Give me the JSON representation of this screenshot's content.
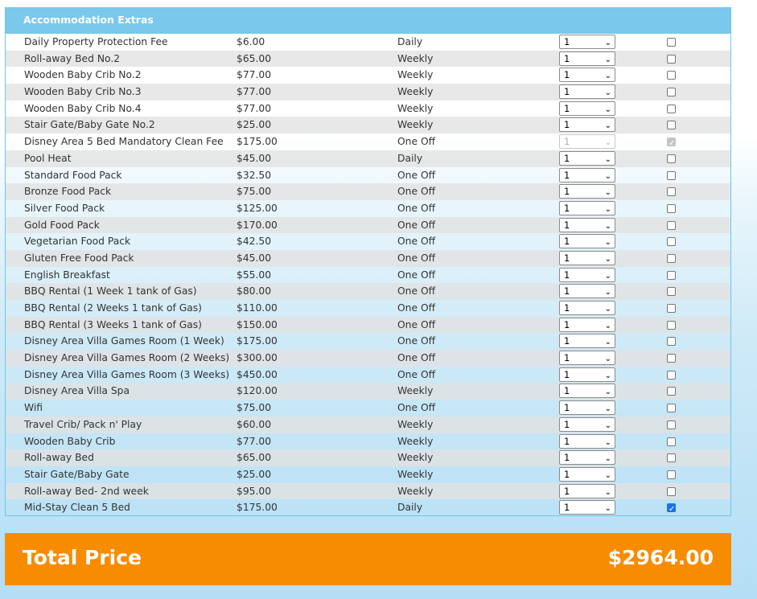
{
  "header": {
    "title": "Accommodation Extras"
  },
  "extras": [
    {
      "name": "Daily Property Protection Fee",
      "price": "$6.00",
      "frequency": "Daily",
      "qty": "1",
      "checked": false,
      "disabled": false
    },
    {
      "name": "Roll-away Bed No.2",
      "price": "$65.00",
      "frequency": "Weekly",
      "qty": "1",
      "checked": false,
      "disabled": false
    },
    {
      "name": "Wooden Baby Crib No.2",
      "price": "$77.00",
      "frequency": "Weekly",
      "qty": "1",
      "checked": false,
      "disabled": false
    },
    {
      "name": "Wooden Baby Crib No.3",
      "price": "$77.00",
      "frequency": "Weekly",
      "qty": "1",
      "checked": false,
      "disabled": false
    },
    {
      "name": "Wooden Baby Crib No.4",
      "price": "$77.00",
      "frequency": "Weekly",
      "qty": "1",
      "checked": false,
      "disabled": false
    },
    {
      "name": "Stair Gate/Baby Gate No.2",
      "price": "$25.00",
      "frequency": "Weekly",
      "qty": "1",
      "checked": false,
      "disabled": false
    },
    {
      "name": "Disney Area 5 Bed Mandatory Clean Fee",
      "price": "$175.00",
      "frequency": "One Off",
      "qty": "1",
      "checked": true,
      "disabled": true
    },
    {
      "name": "Pool Heat",
      "price": "$45.00",
      "frequency": "Daily",
      "qty": "1",
      "checked": false,
      "disabled": false
    },
    {
      "name": "Standard Food Pack",
      "price": "$32.50",
      "frequency": "One Off",
      "qty": "1",
      "checked": false,
      "disabled": false
    },
    {
      "name": "Bronze Food Pack",
      "price": "$75.00",
      "frequency": "One Off",
      "qty": "1",
      "checked": false,
      "disabled": false
    },
    {
      "name": "Silver Food Pack",
      "price": "$125.00",
      "frequency": "One Off",
      "qty": "1",
      "checked": false,
      "disabled": false
    },
    {
      "name": "Gold Food Pack",
      "price": "$170.00",
      "frequency": "One Off",
      "qty": "1",
      "checked": false,
      "disabled": false
    },
    {
      "name": "Vegetarian Food Pack",
      "price": "$42.50",
      "frequency": "One Off",
      "qty": "1",
      "checked": false,
      "disabled": false
    },
    {
      "name": "Gluten Free Food Pack",
      "price": "$45.00",
      "frequency": "One Off",
      "qty": "1",
      "checked": false,
      "disabled": false
    },
    {
      "name": "English Breakfast",
      "price": "$55.00",
      "frequency": "One Off",
      "qty": "1",
      "checked": false,
      "disabled": false
    },
    {
      "name": "BBQ Rental (1 Week 1 tank of Gas)",
      "price": "$80.00",
      "frequency": "One Off",
      "qty": "1",
      "checked": false,
      "disabled": false
    },
    {
      "name": "BBQ Rental (2 Weeks 1 tank of Gas)",
      "price": "$110.00",
      "frequency": "One Off",
      "qty": "1",
      "checked": false,
      "disabled": false
    },
    {
      "name": "BBQ Rental (3 Weeks 1 tank of Gas)",
      "price": "$150.00",
      "frequency": "One Off",
      "qty": "1",
      "checked": false,
      "disabled": false
    },
    {
      "name": "Disney Area Villa Games Room (1 Week)",
      "price": "$175.00",
      "frequency": "One Off",
      "qty": "1",
      "checked": false,
      "disabled": false
    },
    {
      "name": "Disney Area Villa Games Room (2 Weeks)",
      "price": "$300.00",
      "frequency": "One Off",
      "qty": "1",
      "checked": false,
      "disabled": false
    },
    {
      "name": "Disney Area Villa Games Room (3 Weeks)",
      "price": "$450.00",
      "frequency": "One Off",
      "qty": "1",
      "checked": false,
      "disabled": false
    },
    {
      "name": "Disney Area Villa Spa",
      "price": "$120.00",
      "frequency": "Weekly",
      "qty": "1",
      "checked": false,
      "disabled": false
    },
    {
      "name": "Wifi",
      "price": "$75.00",
      "frequency": "One Off",
      "qty": "1",
      "checked": false,
      "disabled": false
    },
    {
      "name": "Travel Crib/ Pack n' Play",
      "price": "$60.00",
      "frequency": "Weekly",
      "qty": "1",
      "checked": false,
      "disabled": false
    },
    {
      "name": "Wooden Baby Crib",
      "price": "$77.00",
      "frequency": "Weekly",
      "qty": "1",
      "checked": false,
      "disabled": false
    },
    {
      "name": "Roll-away Bed",
      "price": "$65.00",
      "frequency": "Weekly",
      "qty": "1",
      "checked": false,
      "disabled": false
    },
    {
      "name": "Stair Gate/Baby Gate",
      "price": "$25.00",
      "frequency": "Weekly",
      "qty": "1",
      "checked": false,
      "disabled": false
    },
    {
      "name": "Roll-away Bed- 2nd week",
      "price": "$95.00",
      "frequency": "Weekly",
      "qty": "1",
      "checked": false,
      "disabled": false
    },
    {
      "name": "Mid-Stay Clean 5 Bed",
      "price": "$175.00",
      "frequency": "Daily",
      "qty": "1",
      "checked": true,
      "disabled": false
    }
  ],
  "total": {
    "label": "Total Price",
    "amount": "$2964.00"
  },
  "colors": {
    "header": "#7ac8ec",
    "total_bar": "#f78c00",
    "checkbox_checked": "#1a73e8"
  }
}
